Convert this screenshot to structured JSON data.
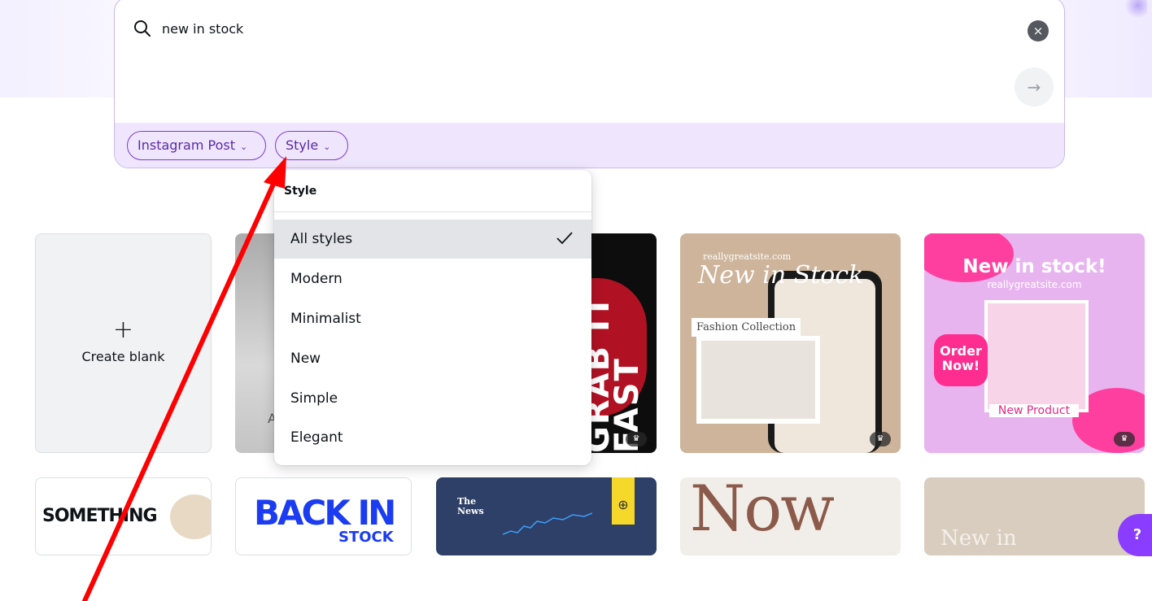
{
  "search": {
    "query": "new in stock",
    "clear_icon": "×",
    "submit_icon": "→"
  },
  "filters": {
    "format_chip": "Instagram Post",
    "style_chip": "Style"
  },
  "dropdown": {
    "title": "Style",
    "options": [
      "All styles",
      "Modern",
      "Minimalist",
      "New",
      "Simple",
      "Elegant"
    ],
    "selected": "All styles"
  },
  "cards": {
    "create_blank_plus": "+",
    "create_blank_label": "Create blank",
    "fashion": {
      "site": "reallygreatsite.com",
      "title": "New in Stock",
      "label": "Fashion Collection"
    },
    "pink": {
      "headline": "New in stock!",
      "site": "reallygreatsite.com",
      "order": "Order Now!",
      "product": "New Product"
    },
    "dark_vertical": "GRAB IT FAST",
    "something": "SOMETHING",
    "back_in": "BACK IN",
    "stock": "STOCK",
    "the_news": "The News",
    "now": "Now",
    "new_in": "New in",
    "partial_letter": "A"
  },
  "help_label": "?",
  "colors": {
    "brand_purple": "#8b3dff",
    "chip_border": "#7d3ad1",
    "filter_bar": "#efe6fd",
    "annotation_red": "#ff0000"
  },
  "icons": {
    "search": "search-icon",
    "clear": "close-icon",
    "submit": "arrow-right-icon",
    "check": "check-icon",
    "chevron": "chevron-down-icon",
    "premium": "crown-icon"
  }
}
